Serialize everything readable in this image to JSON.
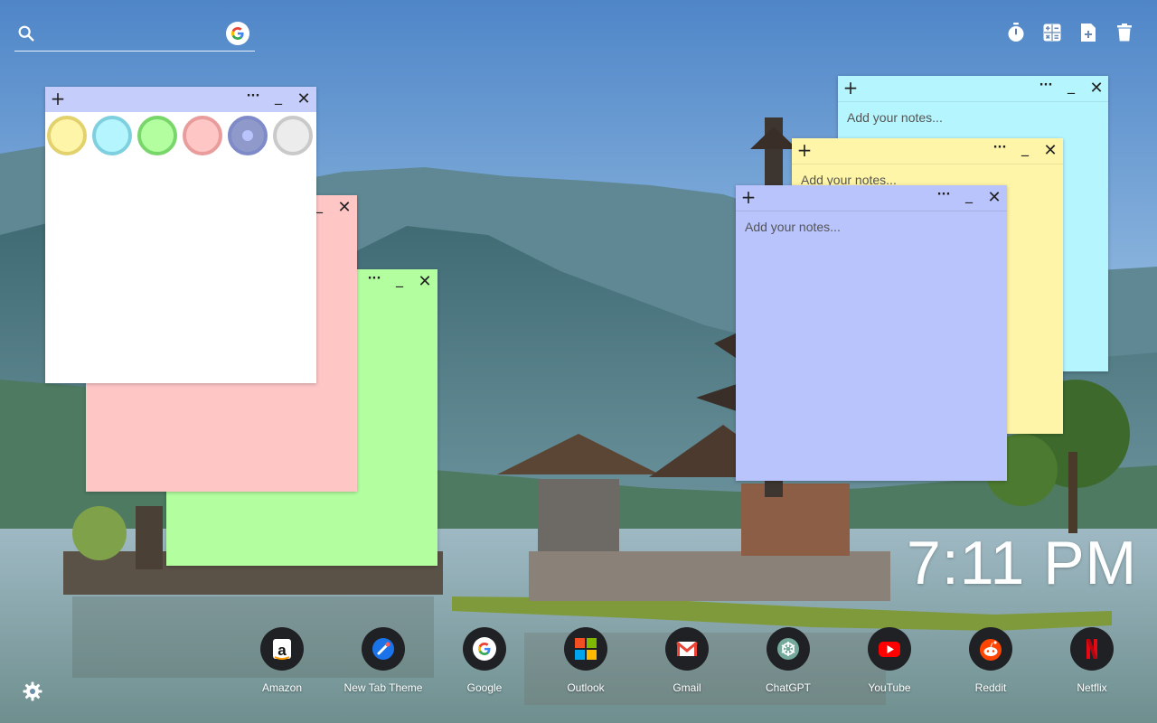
{
  "search": {
    "placeholder": "",
    "value": ""
  },
  "toolbar": {
    "icons": [
      "timer-icon",
      "calculator-icon",
      "add-note-icon",
      "trash-icon"
    ]
  },
  "notes": [
    {
      "id": "white-note",
      "color": "#ffffff",
      "header_color": "#c5cdfb",
      "placeholder": ""
    },
    {
      "id": "pink-note",
      "color": "#ffc6c6",
      "placeholder": ""
    },
    {
      "id": "green-note",
      "color": "#b3ffa0",
      "placeholder": ""
    },
    {
      "id": "cyan-note",
      "color": "#b5f6fe",
      "placeholder": "Add your notes..."
    },
    {
      "id": "yellow-note",
      "color": "#fff5a8",
      "placeholder": "Add your notes..."
    },
    {
      "id": "blue-note",
      "color": "#b9c4fd",
      "placeholder": "Add your notes..."
    }
  ],
  "note_buttons": {
    "add": "+",
    "more": "···",
    "minimize": "_",
    "close": "✕"
  },
  "color_picker": [
    {
      "name": "yellow",
      "fill": "#fff5a8",
      "ring": "#e2d26e"
    },
    {
      "name": "cyan",
      "fill": "#b5f6fe",
      "ring": "#7fd0df"
    },
    {
      "name": "green",
      "fill": "#b3ffa0",
      "ring": "#79d66a"
    },
    {
      "name": "pink",
      "fill": "#ffc6c6",
      "ring": "#e99c9c"
    },
    {
      "name": "blue",
      "fill": "#b9c4fd",
      "ring": "#7f8bc8",
      "selected": true
    },
    {
      "name": "gray",
      "fill": "#ececec",
      "ring": "#c9c9c9"
    }
  ],
  "clock": {
    "time": "7:11 PM"
  },
  "shortcuts": [
    {
      "label": "Amazon",
      "icon": "amazon-icon"
    },
    {
      "label": "New Tab Theme",
      "icon": "new-tab-theme-icon"
    },
    {
      "label": "Google",
      "icon": "google-icon"
    },
    {
      "label": "Outlook",
      "icon": "outlook-icon"
    },
    {
      "label": "Gmail",
      "icon": "gmail-icon"
    },
    {
      "label": "ChatGPT",
      "icon": "chatgpt-icon"
    },
    {
      "label": "YouTube",
      "icon": "youtube-icon"
    },
    {
      "label": "Reddit",
      "icon": "reddit-icon"
    },
    {
      "label": "Netflix",
      "icon": "netflix-icon"
    }
  ],
  "settings": {
    "icon": "gear-icon"
  }
}
